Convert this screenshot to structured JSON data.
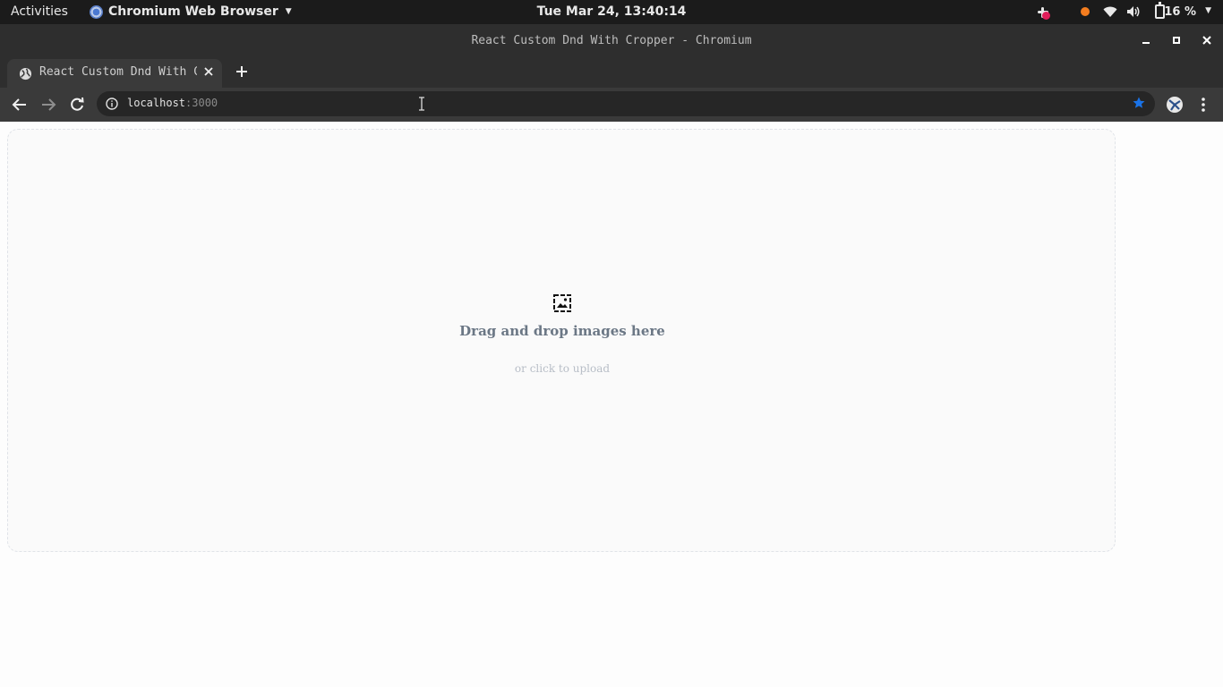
{
  "system_bar": {
    "activities_label": "Activities",
    "app_menu_label": "Chromium Web Browser",
    "clock": "Tue Mar 24, 13:40:14",
    "battery_text": "16 %"
  },
  "window": {
    "title": "React Custom Dnd With Cropper - Chromium"
  },
  "tabs": [
    {
      "title": "React Custom Dnd With Cropper"
    }
  ],
  "address_bar": {
    "host": "localhost",
    "port": ":3000"
  },
  "dropzone": {
    "title": "Drag and drop images here",
    "subtitle": "or click to upload"
  },
  "colors": {
    "bookmark_star": "#1a73e8",
    "notification_dot": "#f47d1f",
    "dropzone_title": "#6b7785"
  }
}
